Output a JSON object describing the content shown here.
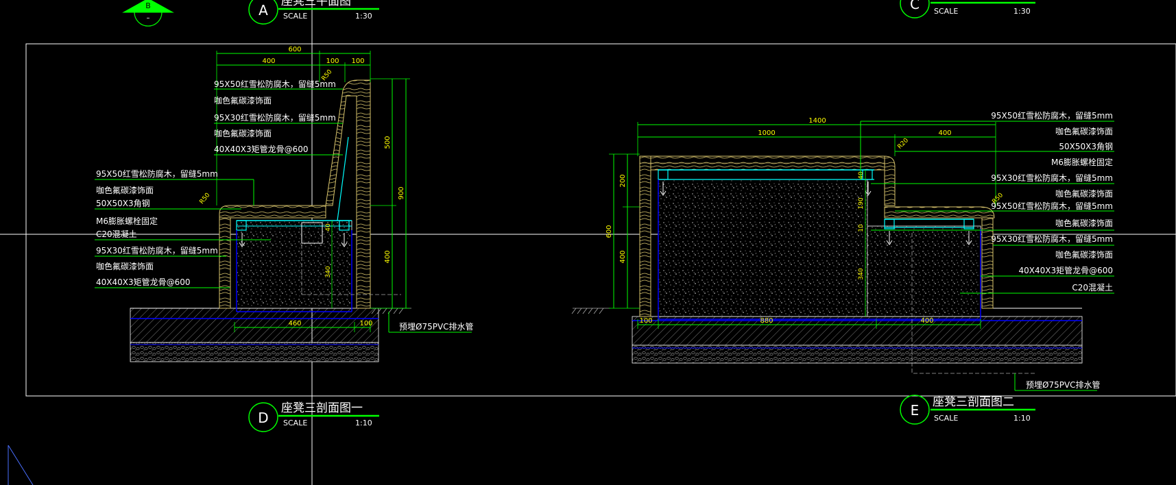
{
  "colors": {
    "background": "#000000",
    "frame": "#ffffff",
    "annotation": "#ffffff",
    "dimension": "#00ff00",
    "dimtext": "#ffff00",
    "steel": "#00ffff",
    "structure": "#0000ff",
    "wood": "#d7c36c"
  },
  "labels": {
    "b_tag": "B",
    "b_tag_sub": "–"
  },
  "titles": {
    "a": {
      "letter": "A",
      "name": "座凳三平面图",
      "scale_label": "SCALE",
      "scale": "1:30"
    },
    "c": {
      "letter": "C",
      "name": "",
      "scale_label": "SCALE",
      "scale": "1:30"
    },
    "d": {
      "letter": "D",
      "name": "座凳三剖面图一",
      "scale_label": "SCALE",
      "scale": "1:10"
    },
    "e": {
      "letter": "E",
      "name": "座凳三剖面图二",
      "scale_label": "SCALE",
      "scale": "1:10"
    }
  },
  "left_section": {
    "notes_top": [
      "95X50红雪松防腐木，留缝5mm",
      "咖色氟碳漆饰面",
      "95X30红雪松防腐木，留缝5mm",
      "咖色氟碳漆饰面",
      "40X40X3矩管龙骨@600"
    ],
    "notes_mid": [
      "95X50红雪松防腐木，留缝5mm",
      "咖色氟碳漆饰面",
      "50X50X3角钢",
      "M6膨胀螺栓固定",
      "C20混凝土",
      "95X30红雪松防腐木，留缝5mm",
      "咖色氟碳漆饰面",
      "40X40X3矩管龙骨@600"
    ],
    "dims": {
      "top_total": "600",
      "top_a": "400",
      "top_b": "100",
      "top_c": "100",
      "r_top": "R50",
      "r_seat": "R50",
      "right_upper": "500",
      "right_lower": "400",
      "right_total": "900",
      "inner_a": "40",
      "inner_b": "340",
      "bottom_a": "460",
      "bottom_b": "100"
    },
    "drain": "预埋Ø75PVC排水管"
  },
  "right_section": {
    "notes": [
      "95X50红雪松防腐木，留缝5mm",
      "咖色氟碳漆饰面",
      "50X50X3角钢",
      "M6膨胀螺栓固定",
      "95X30红雪松防腐木，留缝5mm",
      "咖色氟碳漆饰面",
      "95X50红雪松防腐木，留缝5mm",
      "咖色氟碳漆饰面",
      "95X30红雪松防腐木，留缝5mm",
      "咖色氟碳漆饰面",
      "40X40X3矩管龙骨@600",
      "C20混凝土"
    ],
    "dims": {
      "top_total": "1400",
      "top_a": "1000",
      "top_b": "400",
      "r_top": "R20",
      "r_right": "R50",
      "left_upper": "200",
      "left_lower": "400",
      "left_total": "600",
      "inner_a": "40",
      "inner_b": "190",
      "inner_c": "10",
      "inner_d": "340",
      "bottom_a": "100",
      "bottom_b": "880",
      "bottom_c": "400"
    },
    "drain": "预埋Ø75PVC排水管"
  }
}
